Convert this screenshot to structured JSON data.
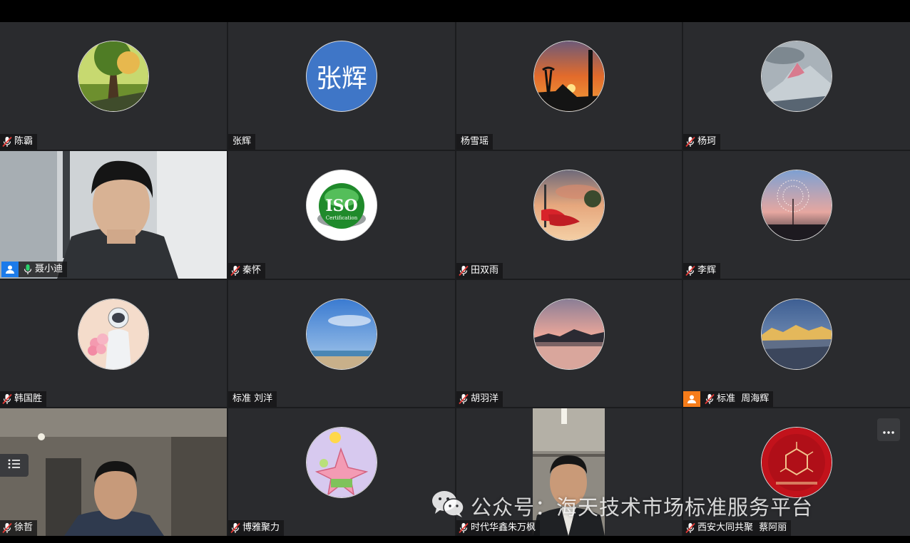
{
  "participants": [
    {
      "name": "陈霸",
      "muted": true
    },
    {
      "name": "张辉",
      "muted": false,
      "avatar_text": "张辉"
    },
    {
      "name": "杨雪瑶",
      "muted": false
    },
    {
      "name": "杨珂",
      "muted": true
    },
    {
      "name": "聂小迪",
      "muted": false,
      "speaking": true,
      "host": true
    },
    {
      "name": "秦怀",
      "muted": true,
      "avatar_text": "ISO",
      "avatar_subtext": "Certification"
    },
    {
      "name": "田双雨",
      "muted": true
    },
    {
      "name": "李辉",
      "muted": true
    },
    {
      "name": "韩国胜",
      "muted": true
    },
    {
      "name": "标准 刘洋",
      "muted": false
    },
    {
      "name": "胡羽洋",
      "muted": true
    },
    {
      "name": "标准  周海辉",
      "muted": true,
      "cohost": true
    },
    {
      "name": "徐哲",
      "muted": true
    },
    {
      "name": "博雅聚力",
      "muted": true
    },
    {
      "name": "时代华鑫朱万枫",
      "muted": true
    },
    {
      "name": "西安大同共聚  蔡阿丽",
      "muted": true
    }
  ],
  "watermark": {
    "text": "公众号：海天技术市场标准服务平台",
    "icon": "wechat-icon"
  },
  "controls": {
    "more_icon": "more-options-icon",
    "list_icon": "list-icon"
  },
  "colors": {
    "tile_bg": "#2a2b2e",
    "active_border": "#21c16b",
    "host_badge": "#1c7bea",
    "cohost_badge": "#f57c1a",
    "muted": "#e53935"
  }
}
